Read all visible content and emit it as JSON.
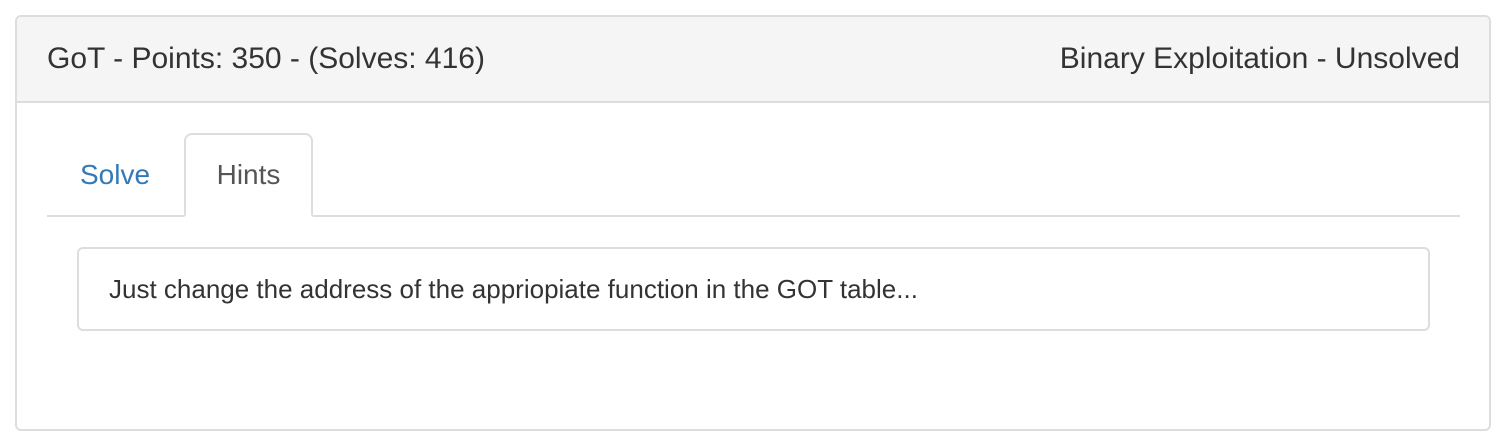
{
  "challenge": {
    "title": "GoT - Points: 350 - (Solves: 416)",
    "status": "Binary Exploitation - Unsolved"
  },
  "tabs": [
    {
      "label": "Solve",
      "active": false
    },
    {
      "label": "Hints",
      "active": true
    }
  ],
  "hints": [
    "Just change the address of the appriopiate function in the GOT table..."
  ],
  "colors": {
    "link": "#337ab7",
    "heading_bg": "#f5f5f5",
    "border": "#dddddd"
  }
}
